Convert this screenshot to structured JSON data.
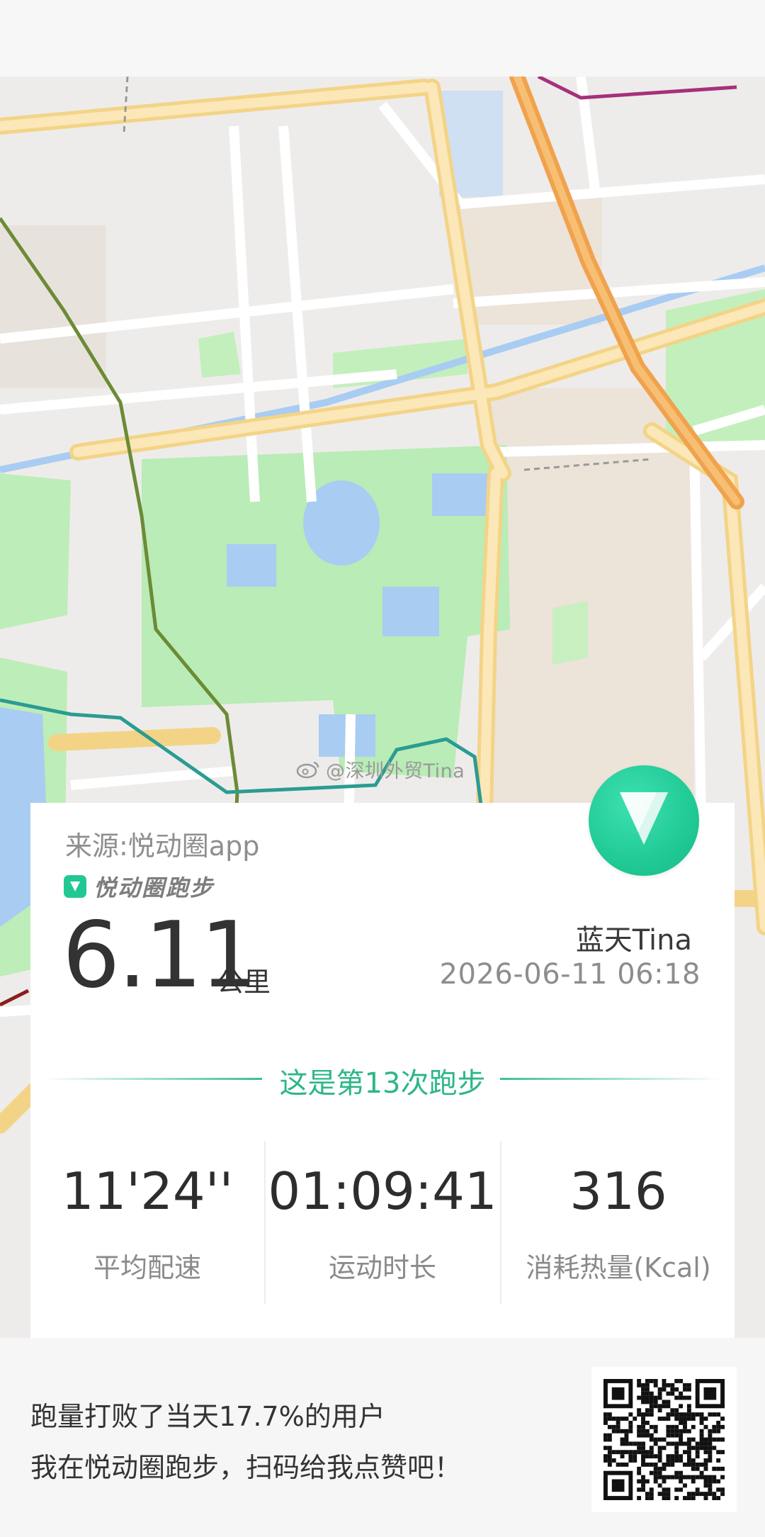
{
  "watermark": "@深圳外贸Tina",
  "card": {
    "source": "来源:悦动圈app",
    "brand_name": "悦动圈跑步",
    "distance_value": "6.11",
    "distance_unit": "公里",
    "user_name": "蓝天Tina",
    "datetime": "2026-06-11 06:18",
    "run_count_text": "这是第13次跑步",
    "stats": [
      {
        "value": "11'24''",
        "label": "平均配速"
      },
      {
        "value": "01:09:41",
        "label": "运动时长"
      },
      {
        "value": "316",
        "label": "消耗热量(Kcal)"
      }
    ]
  },
  "footer": {
    "line1": "跑量打败了当天17.7%的用户",
    "line2": "我在悦动圈跑步，扫码给我点赞吧！"
  },
  "icons": {
    "map": "map-background",
    "logo": "yuedongquan-logo-icon",
    "weibo": "weibo-icon",
    "qr": "qr-code"
  },
  "colors": {
    "accent": "#2db68a",
    "road_major": "#f8d894",
    "park": "#b8ecb4",
    "water": "#a9ccf2"
  }
}
